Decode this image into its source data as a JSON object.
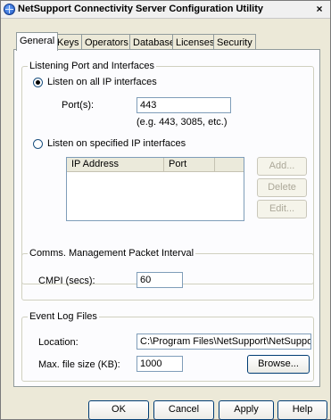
{
  "window": {
    "title": "NetSupport Connectivity Server Configuration Utility",
    "close_glyph": "×"
  },
  "tabs": [
    {
      "label": "General",
      "active": true
    },
    {
      "label": "Keys",
      "active": false
    },
    {
      "label": "Operators",
      "active": false
    },
    {
      "label": "Database",
      "active": false
    },
    {
      "label": "Licenses",
      "active": false
    },
    {
      "label": "Security",
      "active": false
    }
  ],
  "listening": {
    "group_label": "Listening Port and Interfaces",
    "all_interfaces_label": "Listen on all IP interfaces",
    "ports_label": "Port(s):",
    "ports_value": "443",
    "ports_hint": "(e.g. 443, 3085, etc.)",
    "specified_interfaces_label": "Listen on specified IP interfaces",
    "list_columns": [
      "IP Address",
      "Port"
    ],
    "add_label": "Add...",
    "delete_label": "Delete",
    "edit_label": "Edit..."
  },
  "cmpi": {
    "group_label": "Comms. Management Packet Interval",
    "label": "CMPI (secs):",
    "value": "60"
  },
  "eventlog": {
    "group_label": "Event Log Files",
    "location_label": "Location:",
    "location_value": "C:\\Program Files\\NetSupport\\NetSupport Scho",
    "maxsize_label": "Max. file size (KB):",
    "maxsize_value": "1000",
    "browse_label": "Browse..."
  },
  "footer": {
    "ok_label": "OK",
    "cancel_label": "Cancel",
    "apply_label": "Apply",
    "help_label": "Help"
  }
}
